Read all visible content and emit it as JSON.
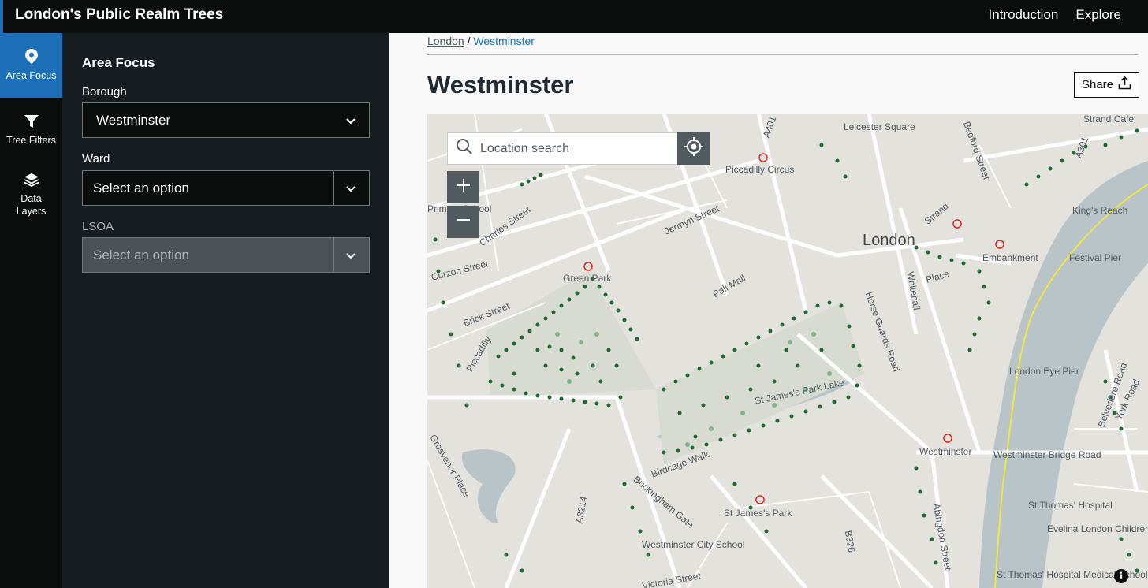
{
  "app": {
    "title": "London's Public Realm Trees",
    "nav": [
      "Introduction",
      "Explore"
    ],
    "accent_color": "#1d70b8"
  },
  "sidebar_nav": [
    {
      "label": "Area Focus",
      "icon": "map-pin-icon"
    },
    {
      "label": "Tree Filters",
      "icon": "filter-icon"
    },
    {
      "label": "Data Layers",
      "icon": "layers-icon"
    }
  ],
  "panel": {
    "heading": "Area Focus",
    "borough": {
      "label": "Borough",
      "value": "Westminster"
    },
    "ward": {
      "label": "Ward",
      "value": "Select an option"
    },
    "lsoa": {
      "label": "LSOA",
      "value": "Select an option"
    }
  },
  "breadcrumb": {
    "root": "London",
    "separator": "/",
    "current": "Westminster"
  },
  "page_title": "Westminster",
  "share_label": "Share",
  "map": {
    "search_placeholder": "Location search",
    "zoom_in": "+",
    "zoom_out": "−",
    "info": "i",
    "tree_color": "#1e6b32",
    "labels": [
      "Leicester Square",
      "Piccadilly Circus",
      "Jermyn Street",
      "London",
      "Embankment",
      "Festival Pier",
      "King's Reach",
      "Strand",
      "Whitehall",
      "Pall Mall",
      "Green Park",
      "Curzon Street",
      "Brick Street",
      "Piccadilly",
      "Primary School",
      "Charles Street",
      "St James's Park Lake",
      "Horse Guards Road",
      "Birdcage Walk",
      "Buckingham Gate",
      "St James's Park",
      "Westminster",
      "Westminster Bridge Road",
      "London Eye Pier",
      "St Thomas' Hospital",
      "Evelina London Childrens",
      "Westminster City School",
      "Grosvenor Place",
      "Belvedere Road",
      "York Road",
      "A3214",
      "B326",
      "A301",
      "A401",
      "Abingdon Street",
      "Victoria Street",
      "St Thomas' Hospital Medical School",
      "Strand Cafe",
      "Bedford Street",
      "Place"
    ]
  }
}
